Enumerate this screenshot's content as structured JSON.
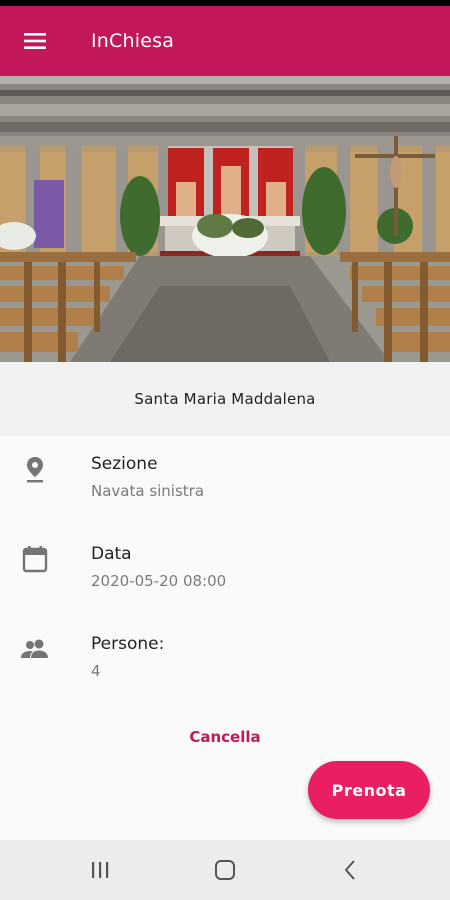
{
  "app": {
    "title": "InChiesa",
    "accent_color": "#c2185b",
    "fab_color": "#e91e63"
  },
  "header": {
    "menu_icon": "hamburger-menu-icon",
    "title": "InChiesa"
  },
  "hero": {
    "image_subject": "church-interior-altar"
  },
  "church": {
    "name": "Santa Maria Maddalena"
  },
  "details": [
    {
      "icon": "location-pin-icon",
      "label": "Sezione",
      "value": "Navata sinistra"
    },
    {
      "icon": "calendar-icon",
      "label": "Data",
      "value": "2020-05-20 08:00"
    },
    {
      "icon": "people-icon",
      "label": "Persone:",
      "value": "4"
    }
  ],
  "actions": {
    "cancel_label": "Cancella",
    "book_label": "Prenota"
  },
  "system_nav": {
    "recents_icon": "recent-apps-icon",
    "home_icon": "home-icon",
    "back_icon": "back-icon"
  }
}
